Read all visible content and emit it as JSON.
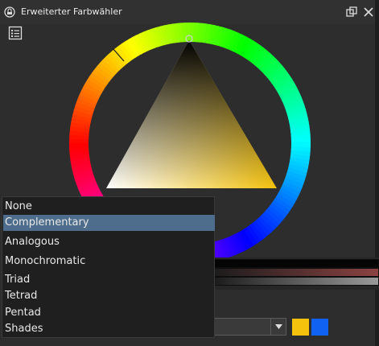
{
  "window": {
    "title": "Erweiterter Farbwähler",
    "icons": [
      "app-icon",
      "float-window-icon",
      "close-icon"
    ]
  },
  "toolbar": {
    "icon": "list-settings-icon"
  },
  "harmony_menu": {
    "items": [
      "None",
      "Complementary",
      "Analogous",
      "Monochromatic",
      "Triad",
      "Tetrad",
      "Pentad",
      "Shades"
    ],
    "selected": "Complementary"
  },
  "swatches": [
    "#f4c20d",
    "#0f62f2"
  ],
  "colors": {
    "accent_selected": "#4e6d8c",
    "triangle_base": "#f4c20d"
  }
}
